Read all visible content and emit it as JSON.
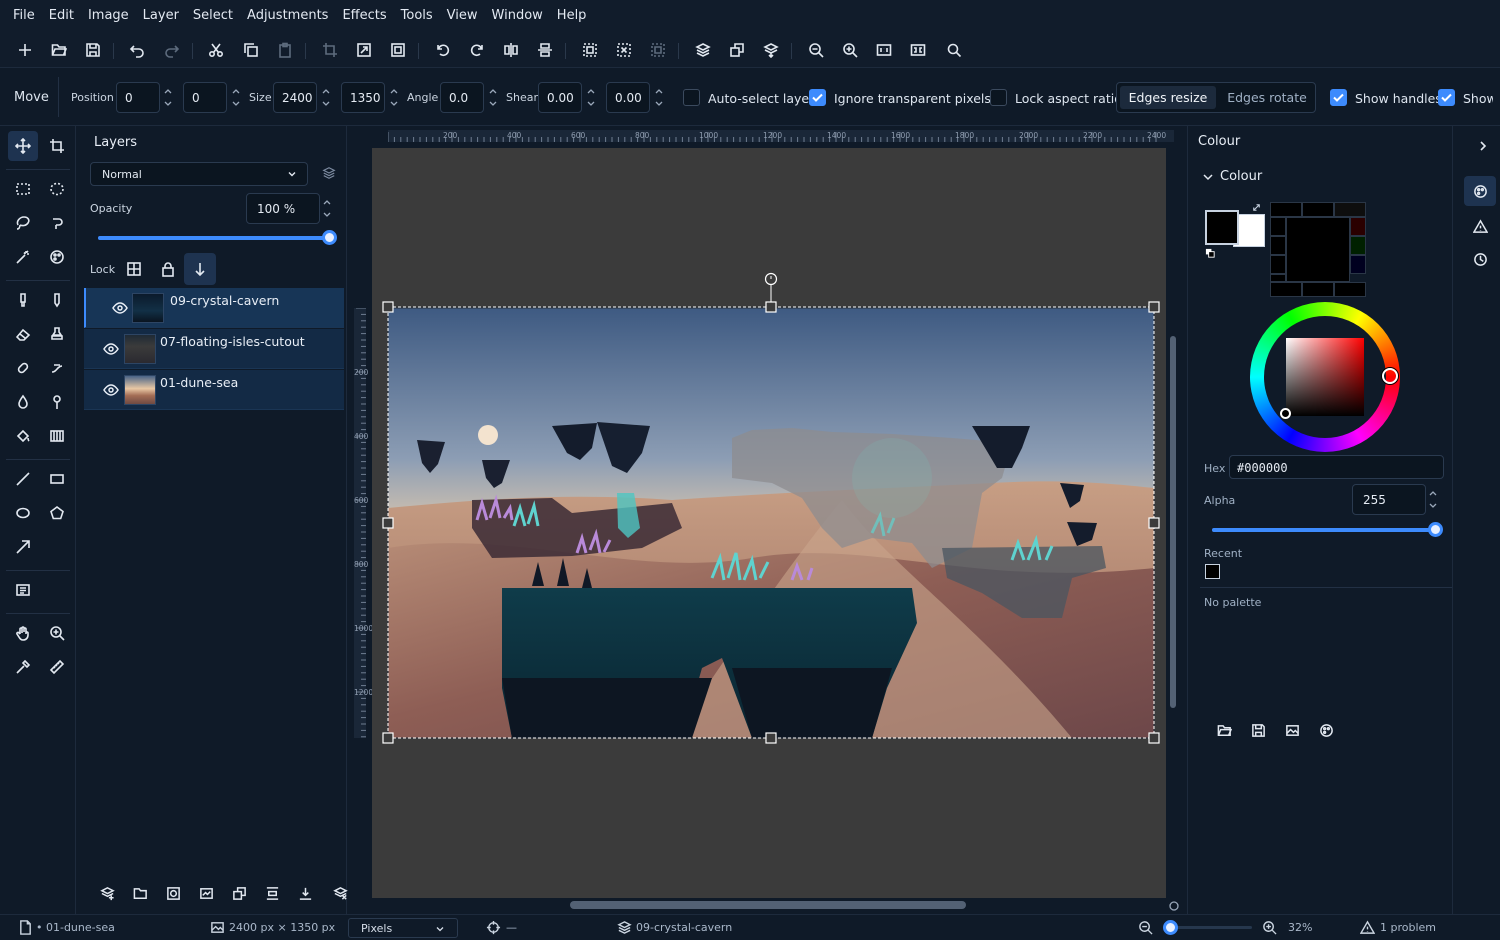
{
  "menu": [
    "File",
    "Edit",
    "Image",
    "Layer",
    "Select",
    "Adjustments",
    "Effects",
    "Tools",
    "View",
    "Window",
    "Help"
  ],
  "toolbar_icons": [
    "new-icon",
    "open-icon",
    "save-icon",
    "undo-icon",
    "redo-icon",
    "cut-icon",
    "copy-icon",
    "paste-icon",
    "crop-icon",
    "resize-image-icon",
    "canvas-size-icon",
    "rotate-ccw-icon",
    "rotate-cw-icon",
    "flip-horizontal-icon",
    "flip-vertical-icon",
    "select-all-icon",
    "deselect-icon",
    "invert-selection-icon",
    "layers-icon",
    "duplicate-layer-icon",
    "merge-down-icon",
    "zoom-out-icon",
    "zoom-in-icon",
    "actual-size-icon",
    "fit-window-icon",
    "search-icon"
  ],
  "options": {
    "tool_name": "Move",
    "position_label": "Position",
    "pos_x": "0",
    "pos_y": "0",
    "size_label": "Size",
    "width": "2400",
    "height": "1350",
    "angle_label": "Angle",
    "angle": "0.0",
    "shear_label": "Shear",
    "shear_x": "0.00",
    "shear_y": "0.00",
    "auto_select": "Auto-select layer",
    "auto_select_checked": false,
    "ignore_transparent": "Ignore transparent pixels",
    "ignore_transparent_checked": true,
    "lock_aspect": "Lock aspect ratio",
    "lock_aspect_checked": false,
    "edges_resize": "Edges resize",
    "edges_rotate": "Edges rotate",
    "show_handles": "Show handles",
    "show_handles_checked": true,
    "show_bounds": "Show",
    "show_bounds_checked": true
  },
  "layers_panel": {
    "title": "Layers",
    "blend_mode": "Normal",
    "opacity_label": "Opacity",
    "opacity": "100 %",
    "opacity_value": 1.0,
    "lock_label": "Lock",
    "layers": [
      {
        "name": "09-crystal-cavern",
        "visible": true,
        "selected": true
      },
      {
        "name": "07-floating-isles-cutout",
        "visible": true,
        "selected": false
      },
      {
        "name": "01-dune-sea",
        "visible": true,
        "selected": false
      }
    ]
  },
  "rulers": {
    "h": [
      "200",
      "400",
      "600",
      "800",
      "1000",
      "1200",
      "1400",
      "1600",
      "1800",
      "2000",
      "2200",
      "2400"
    ],
    "v": [
      "200",
      "400",
      "600",
      "800",
      "1000",
      "1200"
    ]
  },
  "colour_panel": {
    "header": "Colour",
    "section": "Colour",
    "primary": "#000000",
    "secondary": "#ffffff",
    "hex_label": "Hex",
    "hex": "#000000",
    "alpha_label": "Alpha",
    "alpha": "255",
    "alpha_value": 1.0,
    "recent_label": "Recent",
    "recent": [
      "#000000"
    ],
    "palette": "No palette"
  },
  "status": {
    "document": "• 01-dune-sea",
    "dimensions": "2400 px × 1350 px",
    "units": "Pixels",
    "cursor": "—",
    "active_layer": "09-crystal-cavern",
    "zoom": "32%",
    "zoom_value": 0.32,
    "problems": "1 problem"
  },
  "colors": {
    "accent": "#3d8bfd",
    "panel": "#0f1a28",
    "workspace": "#3b3b3b"
  }
}
